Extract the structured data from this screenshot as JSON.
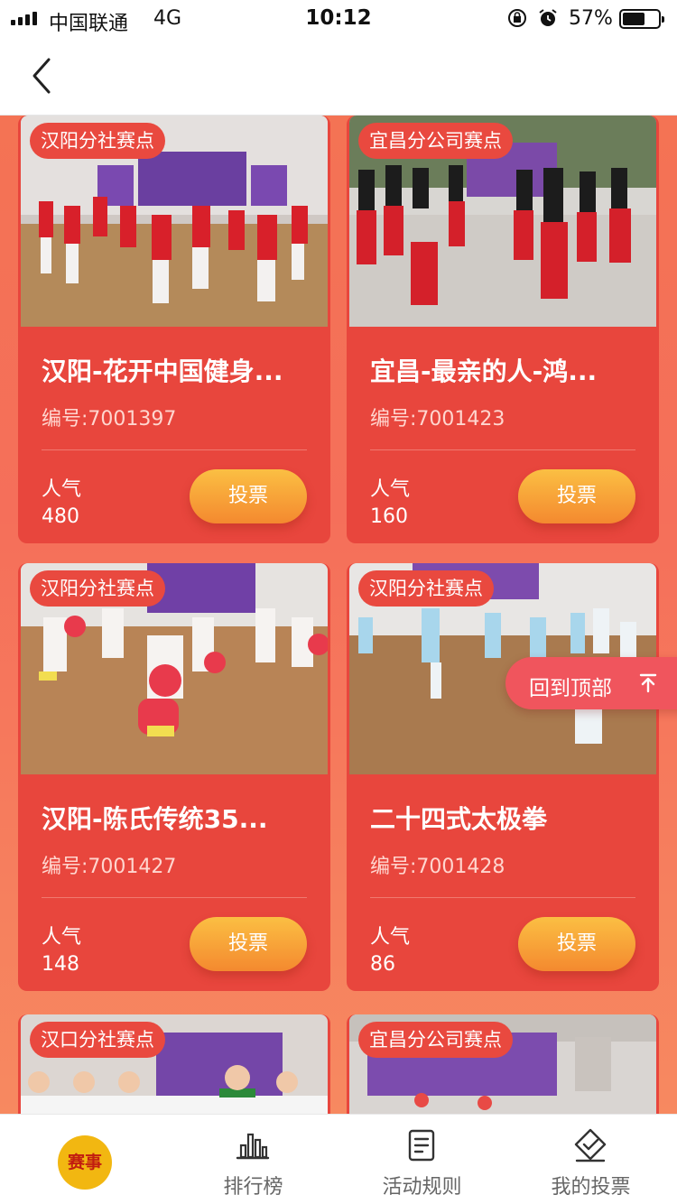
{
  "status_bar": {
    "carrier": "中国联通",
    "network": "4G",
    "time": "10:12",
    "battery": "57%"
  },
  "back_to_top": {
    "label": "回到顶部"
  },
  "cards": [
    {
      "badge": "汉阳分社赛点",
      "title": "汉阳-花开中国健身...",
      "code": "编号:7001397",
      "popularity_label": "人气",
      "popularity": "480",
      "vote_label": "投票"
    },
    {
      "badge": "宜昌分公司赛点",
      "title": "宜昌-最亲的人-鸿...",
      "code": "编号:7001423",
      "popularity_label": "人气",
      "popularity": "160",
      "vote_label": "投票"
    },
    {
      "badge": "汉阳分社赛点",
      "title": "汉阳-陈氏传统35...",
      "code": "编号:7001427",
      "popularity_label": "人气",
      "popularity": "148",
      "vote_label": "投票"
    },
    {
      "badge": "汉阳分社赛点",
      "title": "二十四式太极拳",
      "code": "编号:7001428",
      "popularity_label": "人气",
      "popularity": "86",
      "vote_label": "投票"
    },
    {
      "badge": "汉口分社赛点"
    },
    {
      "badge": "宜昌分公司赛点"
    }
  ],
  "tab_bar": {
    "active_badge": "赛事",
    "tabs": [
      {
        "label": "排行榜",
        "icon": "bar-chart-icon"
      },
      {
        "label": "活动规则",
        "icon": "document-icon"
      },
      {
        "label": "我的投票",
        "icon": "vote-check-icon"
      }
    ]
  },
  "colors": {
    "card": "#e8463d",
    "badge": "#e9493f",
    "vote_button_top": "#fbbf43",
    "vote_button_bottom": "#f4892f",
    "active_tab": "#f2b711"
  }
}
